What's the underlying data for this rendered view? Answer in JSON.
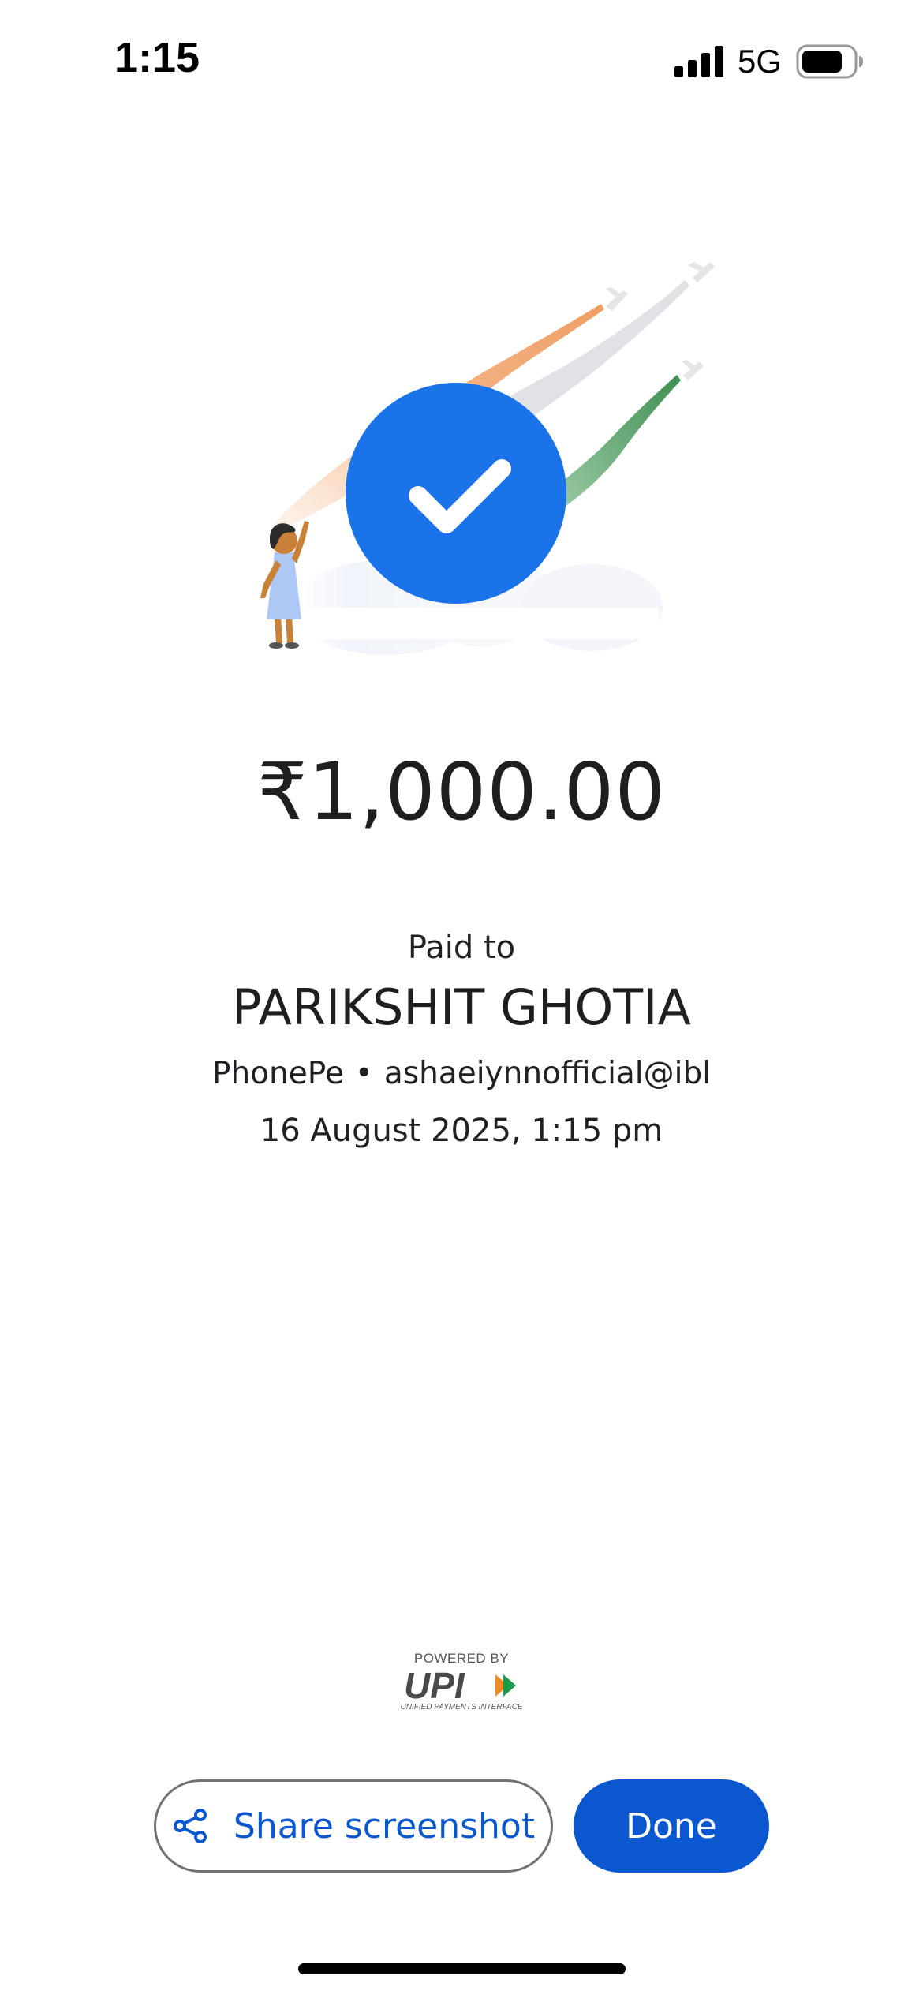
{
  "status_bar": {
    "time": "1:15",
    "network": "5G",
    "icons": [
      "signal-bars-icon",
      "battery-icon"
    ]
  },
  "illustration": {
    "icon": "payment-success-checkmark-icon",
    "colors": {
      "circle": "#1a73e8",
      "saffron": "#f0a36a",
      "white_trail": "#dfe1e5",
      "green": "#5aa56b"
    }
  },
  "payment": {
    "amount": "₹1,000.00",
    "paid_to_label": "Paid to",
    "payee_name": "PARIKSHIT GHOTIA",
    "payee_app": "PhonePe",
    "separator": "•",
    "payee_upi_id": "ashaeiynnofficial@ibl",
    "datetime": "16 August 2025, 1:15 pm"
  },
  "upi_logo": {
    "powered_by": "POWERED BY",
    "mark": "UPI",
    "subtitle": "UNIFIED PAYMENTS INTERFACE"
  },
  "actions": {
    "share_label": "Share screenshot",
    "share_icon": "share-icon",
    "done_label": "Done",
    "accent_color": "#0b57d0"
  }
}
